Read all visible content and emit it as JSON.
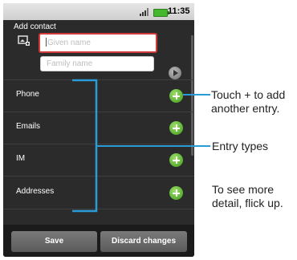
{
  "status_bar": {
    "time": "11:35"
  },
  "header": {
    "title": "Add contact"
  },
  "name_fields": {
    "given_name_placeholder": "Given name",
    "family_name_placeholder": "Family name"
  },
  "entries": [
    {
      "label": "Phone"
    },
    {
      "label": "Emails"
    },
    {
      "label": "IM"
    },
    {
      "label": "Addresses"
    }
  ],
  "buttons": {
    "save": "Save",
    "discard": "Discard changes"
  },
  "annotations": {
    "add_entry": [
      "Touch + to add",
      "another entry."
    ],
    "entry_types": "Entry types",
    "flick_up": [
      "To see more",
      "detail, flick up."
    ]
  },
  "colors": {
    "callout_line": "#2a9bd8",
    "add_button": "#4caf24",
    "given_field_border": "#d23a3a"
  }
}
